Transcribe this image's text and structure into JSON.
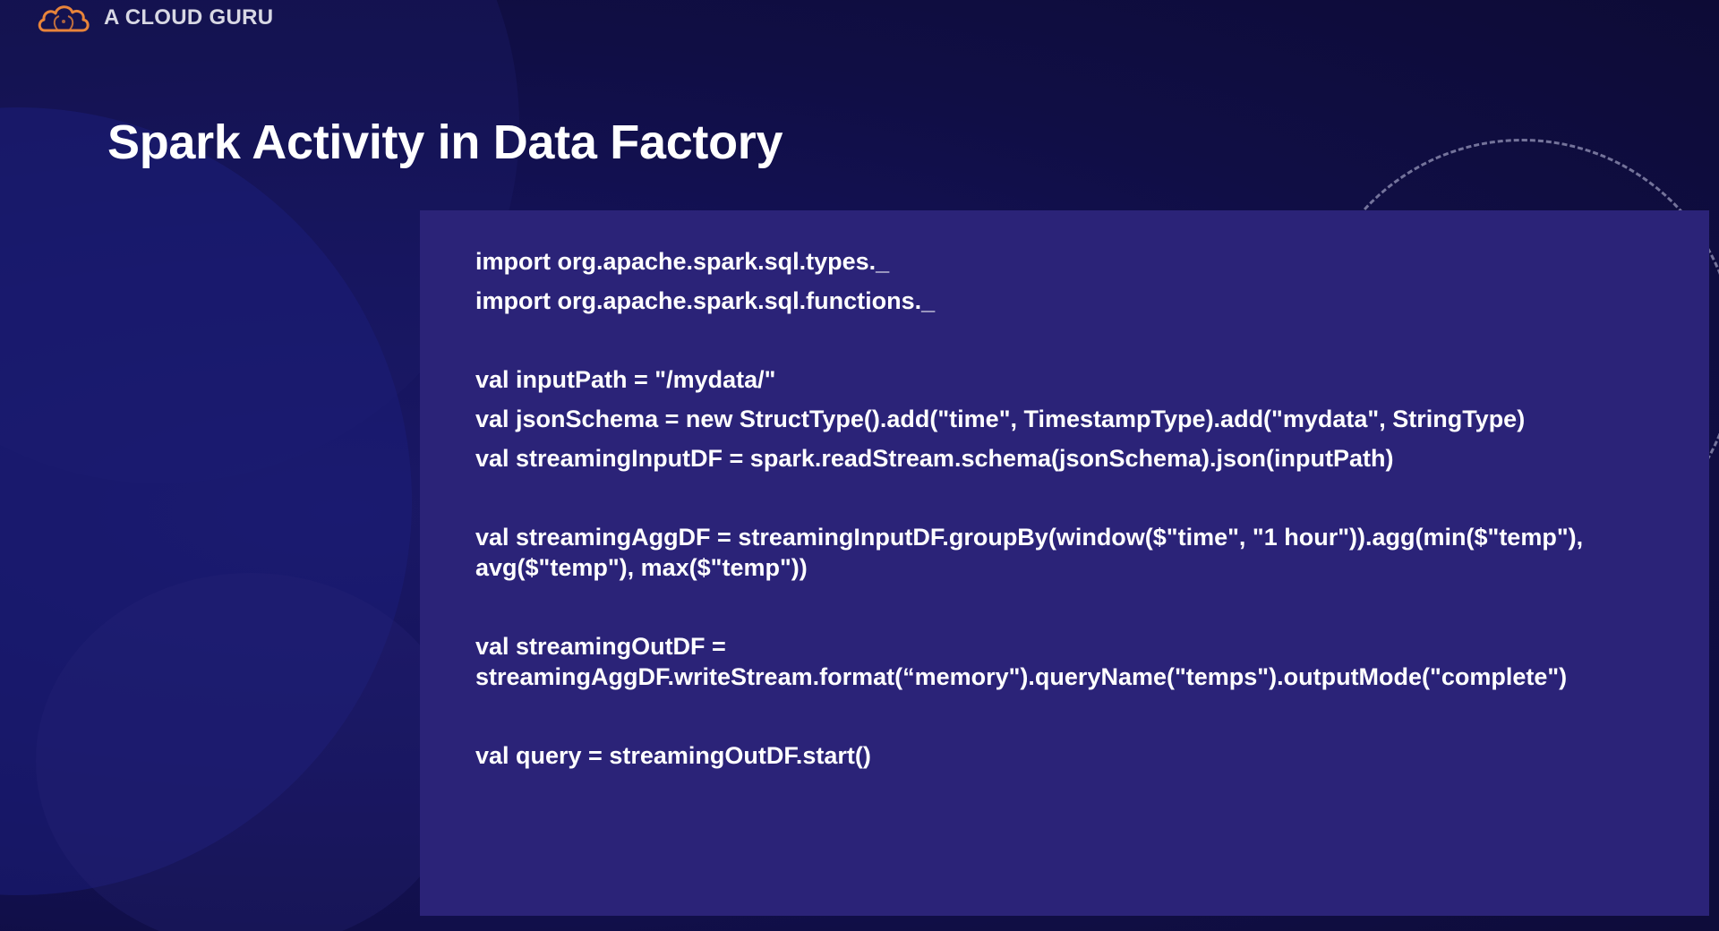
{
  "brand": {
    "logo_icon": "cloud-logo-icon",
    "name": "A CLOUD GURU",
    "accent_color": "#e8843a"
  },
  "slide": {
    "title": "Spark Activity in Data Factory"
  },
  "code": {
    "block1": [
      "import org.apache.spark.sql.types._",
      "import org.apache.spark.sql.functions._"
    ],
    "block2": [
      "val inputPath = \"/mydata/\"",
      "val jsonSchema = new StructType().add(\"time\", TimestampType).add(\"mydata\", StringType)",
      "val streamingInputDF = spark.readStream.schema(jsonSchema).json(inputPath)"
    ],
    "block3": [
      "val streamingAggDF = streamingInputDF.groupBy(window($\"time\", \"1 hour\")).agg(min($\"temp\"),",
      "avg($\"temp\"), max($\"temp\"))"
    ],
    "block4": [
      "val streamingOutDF =",
      "streamingAggDF.writeStream.format(“memory\").queryName(\"temps\").outputMode(\"complete\")"
    ],
    "block5": [
      "val query = streamingOutDF.start()"
    ]
  },
  "colors": {
    "background": "#100e45",
    "panel": "#2b2378",
    "text": "#ffffff"
  }
}
